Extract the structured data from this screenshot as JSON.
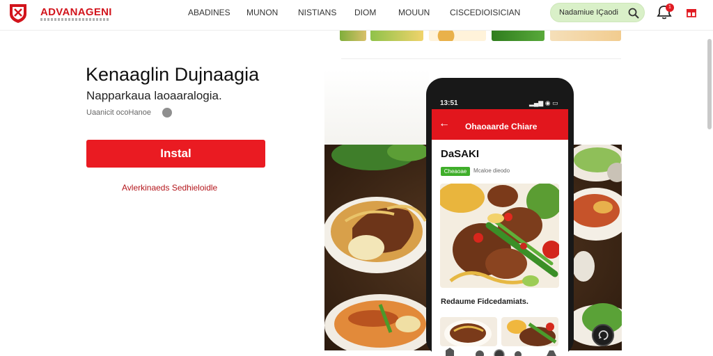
{
  "header": {
    "brand": "ADVANAGENI",
    "nav": [
      {
        "label": "ABADINES"
      },
      {
        "label": "MUNON"
      },
      {
        "label": "NISTIANS"
      },
      {
        "label": "DIOM"
      },
      {
        "label": "MOUUN"
      },
      {
        "label": "CISCEDIOISICIAN"
      }
    ],
    "search": {
      "value": "Nadamiue IÇaodi",
      "icon": "search-icon"
    },
    "notifications": {
      "badge": "1",
      "icon": "notification-icon"
    },
    "gift_icon": "gift-icon"
  },
  "hero": {
    "title": "Kenaaglin Dujnaagia",
    "subtitle": "Napparkaua laoaaralogia.",
    "meta": "Uaanicit ocoHanoe",
    "install_label": "Instal",
    "link": "Avlerkinaeds Sedhieloidle"
  },
  "phone": {
    "time": "13:51",
    "status_icons": "▂▄▆ ◉ ▭",
    "app_title": "Ohaoaarde Chiare",
    "dish_name": "DaSAKI",
    "tag": "Cheaoae",
    "tag_caption": "Mcaloe dieodo",
    "section_label": "Redaume Fidcedamiats."
  },
  "colors": {
    "accent": "#ea1b22",
    "app_bar": "#e2161d",
    "search_bg": "#d9f0c8",
    "tag_green": "#3fae2a"
  }
}
